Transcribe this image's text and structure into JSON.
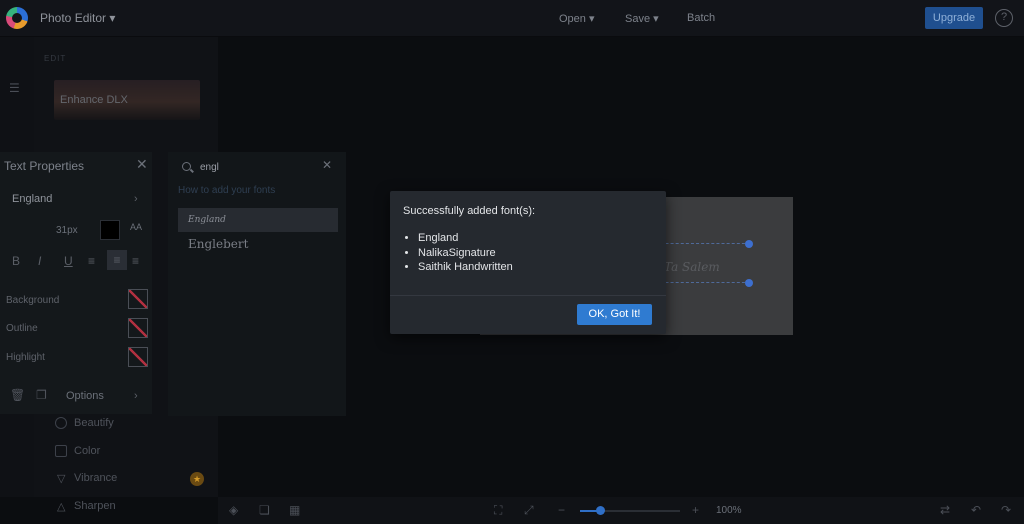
{
  "header": {
    "app_title": "Photo Editor",
    "nav": [
      {
        "label": "Open"
      },
      {
        "label": "Save"
      },
      {
        "label": "Batch"
      }
    ],
    "upgrade_label": "Upgrade",
    "help_label": "?"
  },
  "left_panel": {
    "section_label": "EDIT",
    "thumbnail_label": "Enhance DLX",
    "menu": [
      {
        "label": "Beautify",
        "icon": "circle-icon"
      },
      {
        "label": "Color",
        "icon": "palette-icon"
      },
      {
        "label": "Vibrance",
        "icon": "triangle-icon"
      },
      {
        "label": "Sharpen",
        "icon": "triangle-icon"
      }
    ]
  },
  "text_properties": {
    "title": "Text Properties",
    "font_name": "England",
    "font_size": "31px",
    "color": "#000000",
    "aa_label": "AA",
    "formatting": [
      "B",
      "I",
      "U"
    ],
    "rows": [
      {
        "label": "Background"
      },
      {
        "label": "Outline"
      },
      {
        "label": "Highlight"
      }
    ],
    "options_label": "Options"
  },
  "font_picker": {
    "search_value": "engl",
    "help_link": "How to add your fonts",
    "results": [
      {
        "label": "England"
      },
      {
        "label": "Englebert"
      }
    ]
  },
  "modal": {
    "title": "Successfully added font(s):",
    "fonts": [
      "England",
      "NalikaSignature",
      "Saithik Handwritten"
    ],
    "ok_label": "OK, Got It!"
  },
  "canvas": {
    "text": "Ta Salem"
  },
  "bottom_bar": {
    "zoom_percent": "100%",
    "zoom_level": 0.2
  },
  "colors": {
    "accent": "#2f7bd1",
    "background": "#0b0d10"
  }
}
